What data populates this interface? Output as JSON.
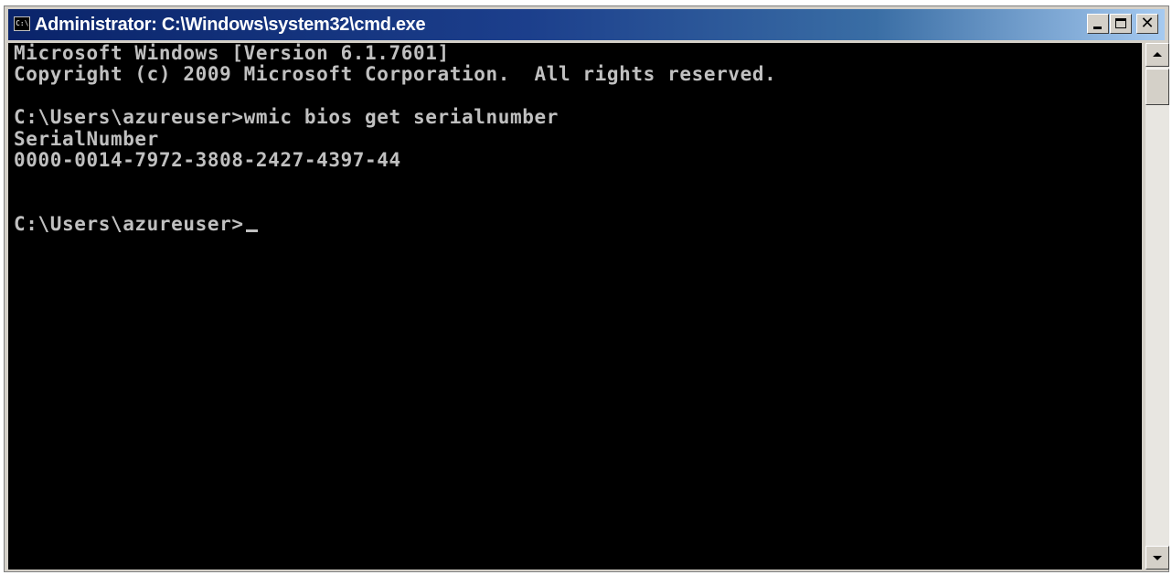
{
  "window": {
    "title": "Administrator: C:\\Windows\\system32\\cmd.exe",
    "icon": "console-icon",
    "icon_label": "C:\\",
    "controls": {
      "minimize": "minimize-icon",
      "maximize": "maximize-icon",
      "close": "close-icon",
      "close_glyph": "✕"
    }
  },
  "console": {
    "lines": [
      "Microsoft Windows [Version 6.1.7601]",
      "Copyright (c) 2009 Microsoft Corporation.  All rights reserved.",
      "",
      "C:\\Users\\azureuser>wmic bios get serialnumber",
      "SerialNumber",
      "0000-0014-7972-3808-2427-4397-44",
      "",
      "",
      "C:\\Users\\azureuser>"
    ],
    "text_color": "#c0c0c0",
    "background_color": "#000000"
  },
  "colors": {
    "titlebar_start": "#0a246a",
    "titlebar_end": "#a6caf0",
    "chrome": "#d4d0c8"
  }
}
